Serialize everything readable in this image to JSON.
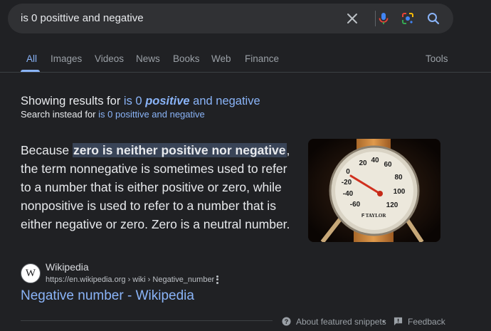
{
  "search": {
    "query": "is 0 posittive and negative"
  },
  "tabs": [
    {
      "label": "All",
      "active": true
    },
    {
      "label": "Images"
    },
    {
      "label": "Videos"
    },
    {
      "label": "News"
    },
    {
      "label": "Books"
    },
    {
      "label": "Web"
    },
    {
      "label": "Finance"
    }
  ],
  "tools_label": "Tools",
  "correction": {
    "showing_prefix": "Showing results for",
    "corrected_part1": "is 0",
    "corrected_bold": "positive",
    "corrected_part2": "and negative",
    "instead_prefix": "Search instead for",
    "original_query": "is 0 posittive and negative"
  },
  "snippet": {
    "before": "Because ",
    "highlight": "zero is neither positive nor negative",
    "after": ", the term nonnegative is sometimes used to refer to a number that is either positive or zero, while nonpositive is used to refer to a number that is either negative or zero. Zero is a neutral number."
  },
  "source": {
    "favicon_letter": "W",
    "name": "Wikipedia",
    "url": "https://en.wikipedia.org › wiki › Negative_number",
    "title": "Negative number - Wikipedia"
  },
  "thermometer": {
    "brand": "TAYLOR",
    "scale_labels": [
      "20",
      "40",
      "60",
      "0",
      "80",
      "-20",
      "100",
      "-40",
      "120",
      "-60"
    ],
    "unit": "F"
  },
  "footer": {
    "about_label": "About featured snippets",
    "separator": "•",
    "feedback_label": "Feedback"
  },
  "colors": {
    "background": "#202124",
    "search_bar": "#303134",
    "link": "#8ab4f8",
    "highlight": "#394457"
  }
}
